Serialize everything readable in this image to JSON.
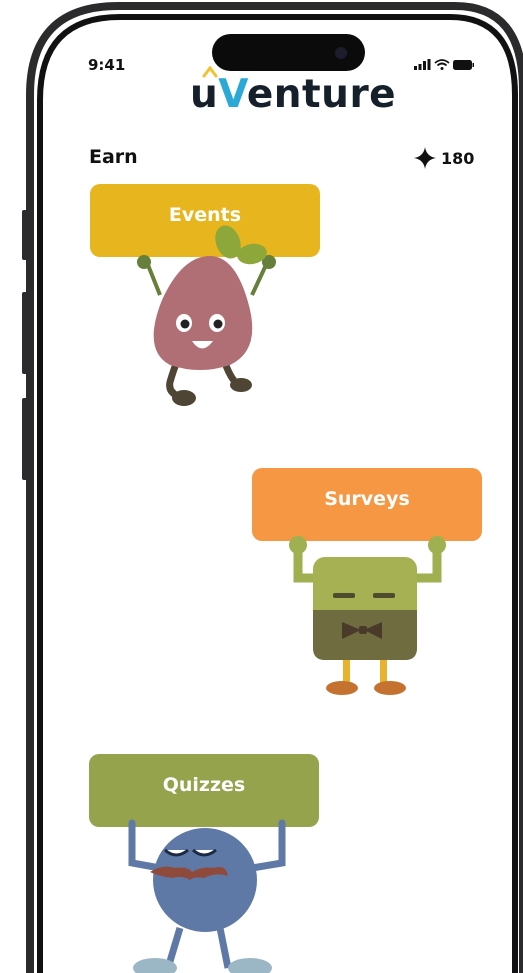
{
  "status_bar": {
    "time": "9:41",
    "signal_icon": "signal-bars-icon",
    "wifi_icon": "wifi-icon",
    "battery_icon": "battery-icon"
  },
  "brand": {
    "prefix": "u",
    "accent": "V",
    "suffix": "enture",
    "accent_color": "#2aa9d6"
  },
  "header": {
    "title": "Earn",
    "points": "180",
    "points_icon": "sparkle-icon"
  },
  "cards": [
    {
      "label": "Events",
      "color": "#e7b61e",
      "mascot": "blob-mascot"
    },
    {
      "label": "Surveys",
      "color": "#f59743",
      "mascot": "box-mascot"
    },
    {
      "label": "Quizzes",
      "color": "#95a34d",
      "mascot": "ball-mascot"
    }
  ]
}
